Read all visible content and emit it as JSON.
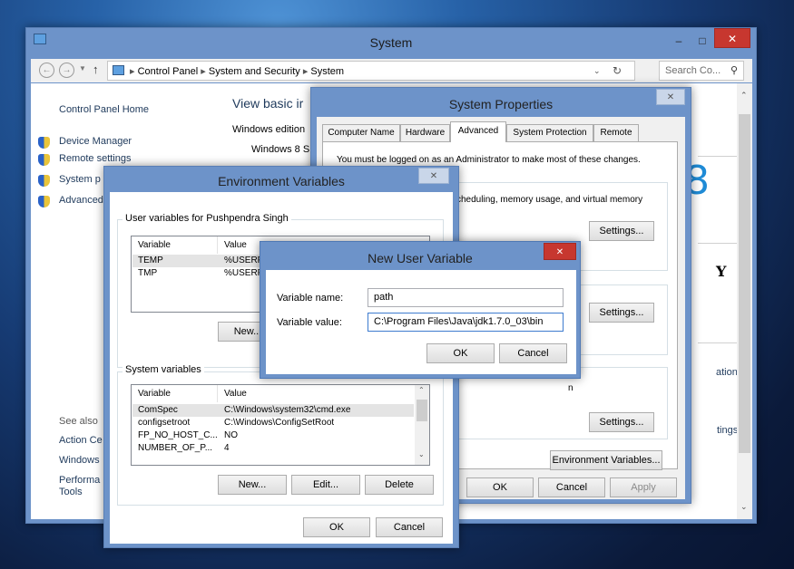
{
  "system_window": {
    "title": "System",
    "controls": {
      "minimize": "–",
      "maximize": "□",
      "close": "✕"
    },
    "breadcrumb": [
      "Control Panel",
      "System and Security",
      "System"
    ],
    "search_placeholder": "Search Co...",
    "sidebar": {
      "home": "Control Panel Home",
      "items": [
        "Device Manager",
        "Remote settings",
        "System p",
        "Advanced"
      ],
      "see_also": "See also",
      "see_also_items": [
        "Action Ce",
        "Windows",
        "Performa",
        "Tools"
      ]
    },
    "main_heading": "View basic ir",
    "edition_label": "Windows edition",
    "edition_value": "Windows 8 S",
    "big_digit": "8",
    "logo_letter": "Y",
    "link_ation": "ation",
    "link_tings": "tings"
  },
  "system_properties": {
    "title": "System Properties",
    "close": "✕",
    "tabs": [
      "Computer Name",
      "Hardware",
      "Advanced",
      "System Protection",
      "Remote"
    ],
    "active_tab": "Advanced",
    "admin_note": "You must be logged on as an Administrator to make most of these changes.",
    "perf_desc": "cheduling, memory usage, and virtual memory",
    "startup_frag": "n",
    "settings_label": "Settings...",
    "env_vars_button": "Environment Variables...",
    "ok": "OK",
    "cancel": "Cancel",
    "apply": "Apply"
  },
  "env_vars": {
    "title": "Environment Variables",
    "close": "✕",
    "user_group_label": "User variables for Pushpendra Singh",
    "col_variable": "Variable",
    "col_value": "Value",
    "user_vars": [
      {
        "name": "TEMP",
        "value": "%USERP"
      },
      {
        "name": "TMP",
        "value": "%USERP"
      }
    ],
    "user_new": "New...",
    "sys_group_label": "System variables",
    "sys_vars": [
      {
        "name": "ComSpec",
        "value": "C:\\Windows\\system32\\cmd.exe"
      },
      {
        "name": "configsetroot",
        "value": "C:\\Windows\\ConfigSetRoot"
      },
      {
        "name": "FP_NO_HOST_C...",
        "value": "NO"
      },
      {
        "name": "NUMBER_OF_P...",
        "value": "4"
      }
    ],
    "sys_new": "New...",
    "sys_edit": "Edit...",
    "sys_delete": "Delete",
    "ok": "OK",
    "cancel": "Cancel"
  },
  "new_user_var": {
    "title": "New User Variable",
    "close": "✕",
    "name_label": "Variable name:",
    "name_value": "path",
    "value_label": "Variable value:",
    "value_value": "C:\\Program Files\\Java\\jdk1.7.0_03\\bin",
    "ok": "OK",
    "cancel": "Cancel"
  },
  "colors": {
    "accent": "#6d93c9",
    "close_red": "#c7372f",
    "selected_row": "#e4e4e4",
    "link": "#1e395b"
  }
}
